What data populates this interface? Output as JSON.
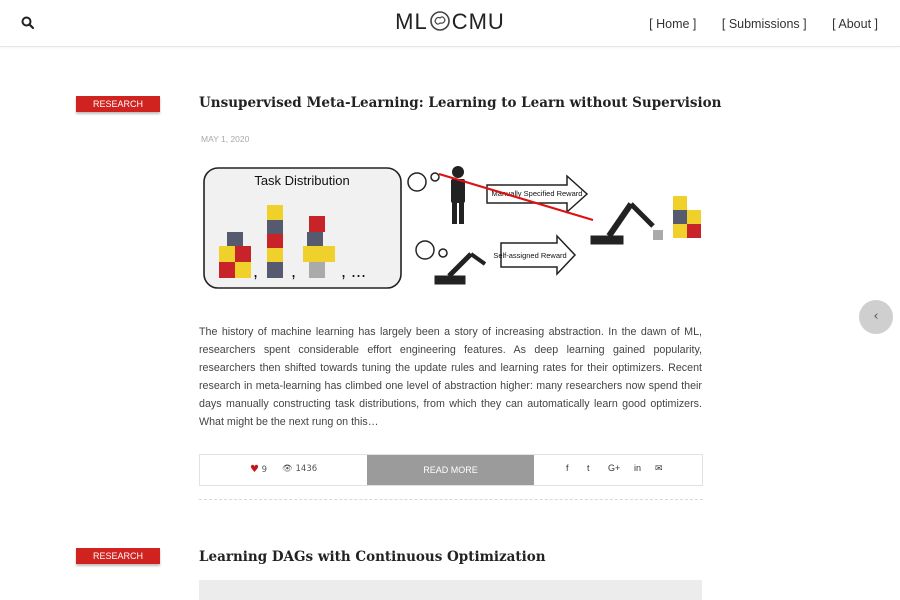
{
  "header": {
    "logo_left": "ML",
    "logo_right": "CMU",
    "nav": [
      "[ Home ]",
      "[ Submissions ]",
      "[ About ]"
    ]
  },
  "posts": [
    {
      "category": "RESEARCH",
      "title": "Unsupervised Meta-Learning: Learning to Learn without Supervision",
      "date": "MAY 1, 2020",
      "figure": {
        "task_distribution": "Task Distribution",
        "dots": ", ...",
        "manual_reward": "Manually Specified Reward",
        "self_reward": "Self-assigned Reward"
      },
      "excerpt": "The history of machine learning has largely been a story of increasing abstraction. In the dawn of ML, researchers spent considerable effort engineering features. As deep learning gained popularity, researchers then shifted towards tuning the update rules and learning rates for their optimizers. Recent research in meta-learning has climbed one level of abstraction higher: many researchers now spend their days manually constructing task distributions, from which they can automatically learn good optimizers. What might be the next rung on this…",
      "likes": "9",
      "views": "1436",
      "read_more": "READ MORE",
      "share": [
        "f",
        "t",
        "G+",
        "in",
        "✉"
      ]
    },
    {
      "category": "RESEARCH",
      "title": "Learning DAGs with Continuous Optimization"
    }
  ],
  "side_button": "‹",
  "colors": {
    "accent": "#d0231f",
    "read_more_bg": "#9b9b9b"
  }
}
